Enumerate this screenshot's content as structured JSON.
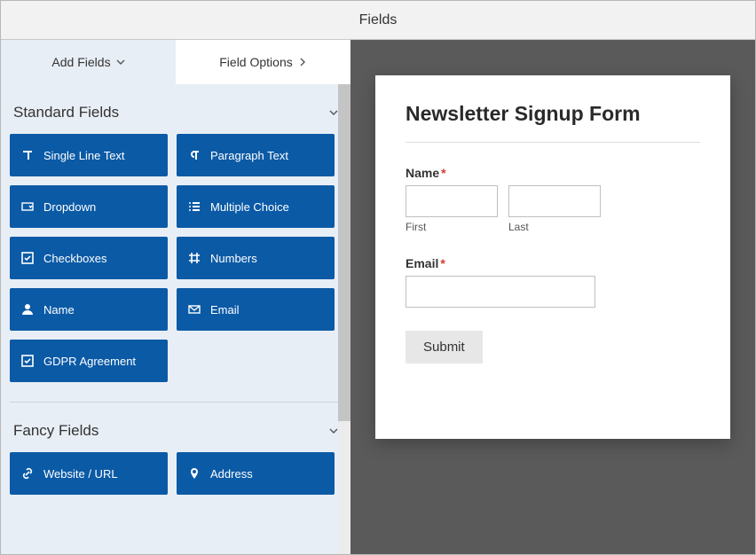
{
  "title": "Fields",
  "tabs": {
    "add": "Add Fields",
    "options": "Field Options"
  },
  "sections": {
    "standard": {
      "title": "Standard Fields",
      "items": [
        {
          "label": "Single Line Text",
          "icon": "text"
        },
        {
          "label": "Paragraph Text",
          "icon": "paragraph"
        },
        {
          "label": "Dropdown",
          "icon": "dropdown"
        },
        {
          "label": "Multiple Choice",
          "icon": "list"
        },
        {
          "label": "Checkboxes",
          "icon": "check"
        },
        {
          "label": "Numbers",
          "icon": "hash"
        },
        {
          "label": "Name",
          "icon": "user"
        },
        {
          "label": "Email",
          "icon": "mail"
        },
        {
          "label": "GDPR Agreement",
          "icon": "check"
        }
      ]
    },
    "fancy": {
      "title": "Fancy Fields",
      "items": [
        {
          "label": "Website / URL",
          "icon": "link"
        },
        {
          "label": "Address",
          "icon": "pin"
        }
      ]
    }
  },
  "preview": {
    "heading": "Newsletter Signup Form",
    "name_label": "Name",
    "first_sub": "First",
    "last_sub": "Last",
    "email_label": "Email",
    "submit": "Submit"
  }
}
